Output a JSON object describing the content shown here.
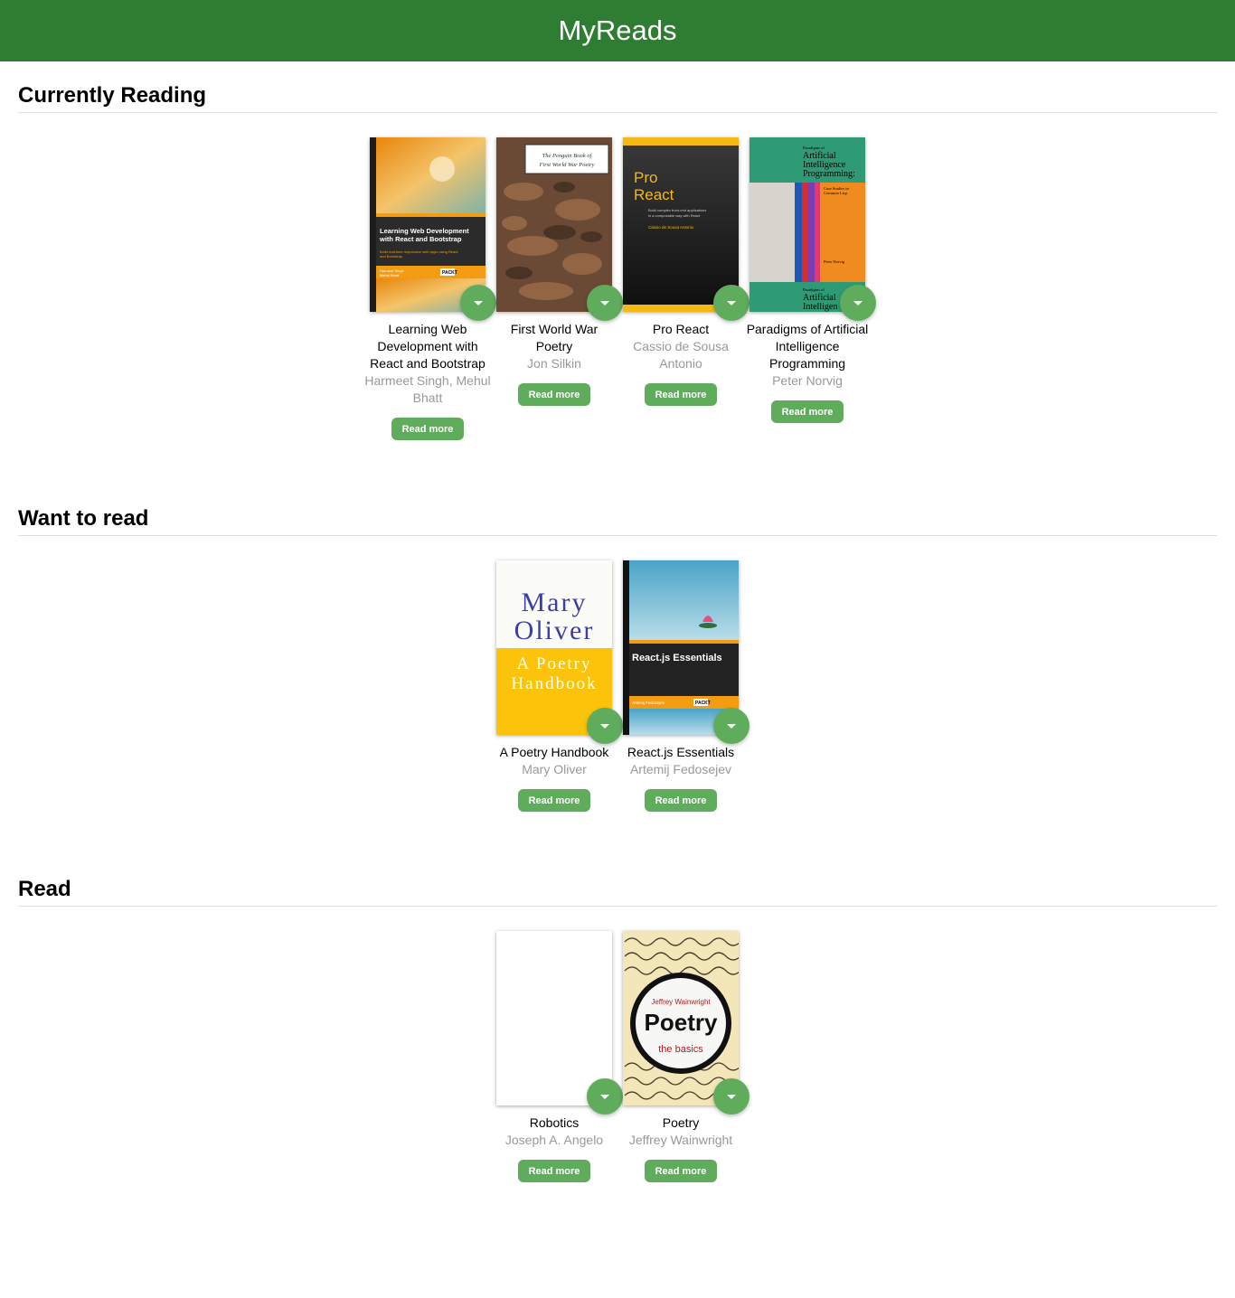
{
  "app": {
    "title": "MyReads"
  },
  "shelves": [
    {
      "title": "Currently Reading",
      "books": [
        {
          "title": "Learning Web Development with React and Bootstrap",
          "authors": "Harmeet Singh, Mehul Bhatt",
          "button": "Read more",
          "cover_text": {
            "heading": "Learning Web Development with React and Bootstrap",
            "sub": "Build real-time responsive web apps using React and Bootstrap",
            "names": "Harmeet Singh\nMehul Bhatt",
            "publisher": "PACKT"
          }
        },
        {
          "title": "First World War Poetry",
          "authors": "Jon Silkin",
          "button": "Read more",
          "cover_text": {
            "heading": "The Penguin Book of\nFirst World War Poetry"
          }
        },
        {
          "title": "Pro React",
          "authors": "Cassio de Sousa Antonio",
          "button": "Read more",
          "cover_text": {
            "heading": "Pro\nReact",
            "sub": "Build complex front-end applications\nin a composable way with React",
            "names": "Cássio de Sousa Antonio"
          }
        },
        {
          "title": "Paradigms of Artificial Intelligence Programming",
          "authors": "Peter Norvig",
          "button": "Read more",
          "cover_text": {
            "heading": "Paradigms of\nArtificial\nIntelligence\nProgramming:",
            "sub": "Case Studies in\nCommon Lisp",
            "names": "Peter Norvig"
          }
        }
      ]
    },
    {
      "title": "Want to read",
      "books": [
        {
          "title": "A Poetry Handbook",
          "authors": "Mary Oliver",
          "button": "Read more",
          "cover_text": {
            "heading": "Mary\nOliver",
            "sub": "A Poetry\nHandbook"
          }
        },
        {
          "title": "React.js Essentials",
          "authors": "Artemij Fedosejev",
          "button": "Read more",
          "cover_text": {
            "heading": "React.js Essentials",
            "names": "Artemij Fedosejev",
            "publisher": "PACKT"
          }
        }
      ]
    },
    {
      "title": "Read",
      "books": [
        {
          "title": "Robotics",
          "authors": "Joseph A. Angelo",
          "button": "Read more",
          "cover_text": {}
        },
        {
          "title": "Poetry",
          "authors": "Jeffrey Wainwright",
          "button": "Read more",
          "cover_text": {
            "names": "Jeffrey Wainwright",
            "heading": "Poetry",
            "sub": "the basics"
          }
        }
      ]
    }
  ],
  "icons": {
    "shelf_changer": "chevron-down-icon"
  },
  "colors": {
    "header": "#2e7d32",
    "button": "#60ac5d",
    "author": "#999999"
  }
}
